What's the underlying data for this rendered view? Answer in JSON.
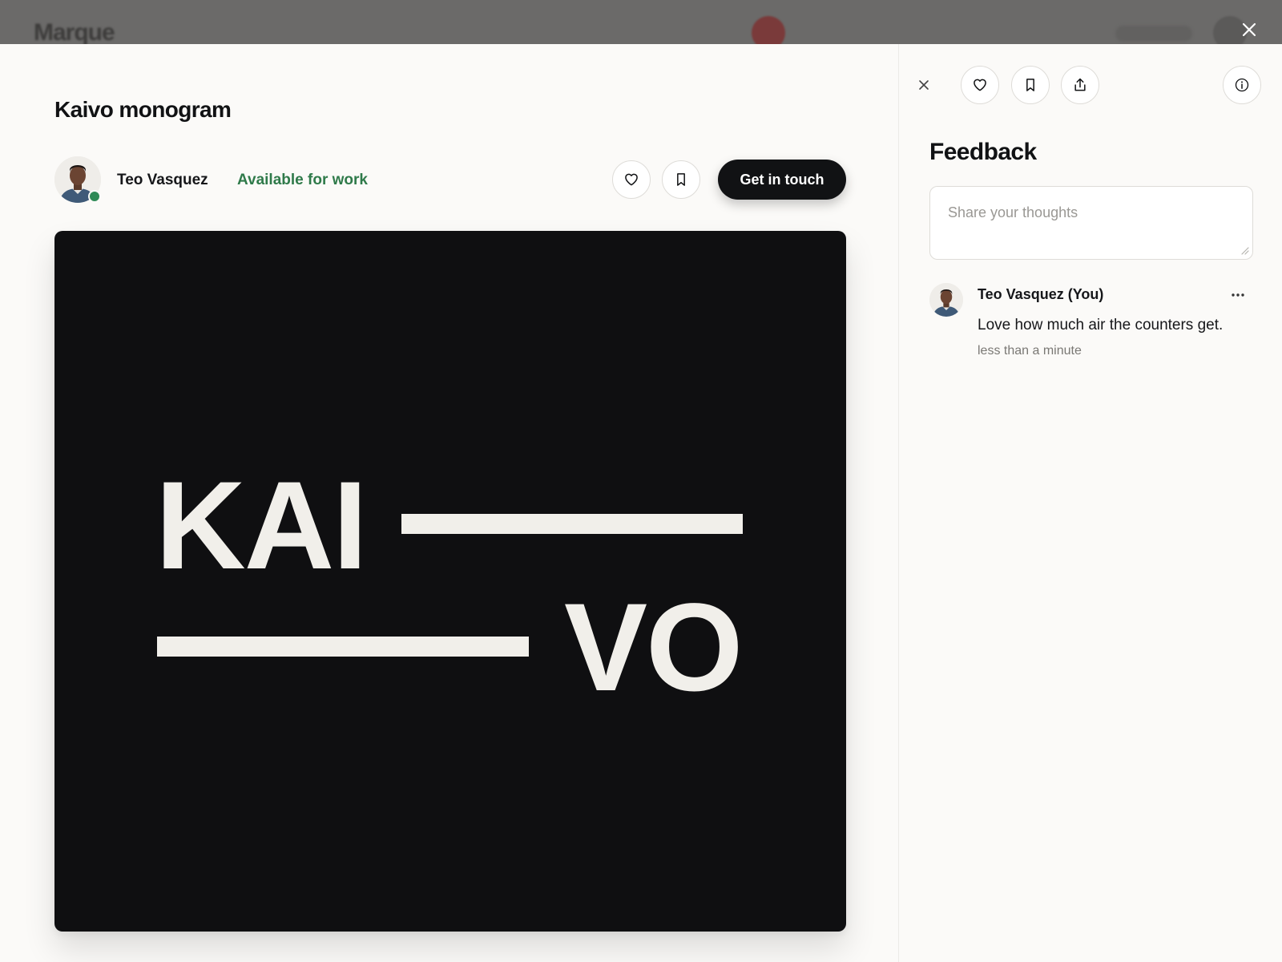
{
  "background": {
    "logo": "Marque"
  },
  "shot": {
    "title": "Kaivo monogram",
    "artwork": {
      "line1": "KAI",
      "line2": "VO"
    }
  },
  "author": {
    "name": "Teo Vasquez",
    "availability": "Available for work",
    "cta_label": "Get in touch"
  },
  "feedback": {
    "title": "Feedback",
    "placeholder": "Share your thoughts",
    "comments": [
      {
        "author": "Teo Vasquez",
        "you_tag": "(You)",
        "body": "Love how much air the counters get.",
        "time": "less than a minute"
      }
    ]
  },
  "icons": {
    "close": "close-icon",
    "like": "heart-icon",
    "save": "bookmark-icon",
    "share": "share-icon",
    "info": "info-icon",
    "more": "more-icon"
  },
  "colors": {
    "accent_dark": "#111214",
    "available_green": "#2f7a4a",
    "online_dot": "#2f8a57",
    "artwork_bg": "#0f0f11",
    "artwork_fg": "#f1efea"
  }
}
